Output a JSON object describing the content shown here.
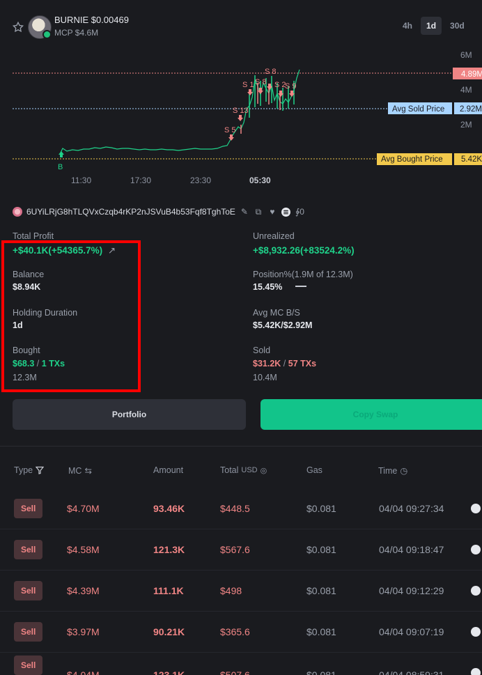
{
  "token": {
    "name_price": "BURNIE $0.00469",
    "mcp": "MCP $4.6M"
  },
  "timeframes": [
    "4h",
    "1d",
    "30d"
  ],
  "chart": {
    "y_ticks": [
      "6M",
      "4M",
      "2M"
    ],
    "x_ticks": [
      "11:30",
      "17:30",
      "23:30",
      "05:30"
    ],
    "current_price_tag": "4.89M",
    "avg_sold_label": "Avg Sold Price",
    "avg_sold_value": "2.92M",
    "avg_bought_label": "Avg Bought Price",
    "avg_bought_value": "5.42K",
    "markers": [
      "S 8",
      "S 1",
      "S 8",
      "S 2",
      "S 9",
      "S 13",
      "S 5",
      "B"
    ],
    "colors": {
      "up": "#1fd28a",
      "down": "#f08585",
      "sold_tag": "#a8d4ff",
      "bought_tag": "#f2c94c"
    }
  },
  "wallet": {
    "address": "6UYiLRjG8hTLQVxCzqb4rKP2nJSVuB4b53Fqf8TghToE",
    "extra": "0"
  },
  "stats": {
    "total_profit_label": "Total Profit",
    "total_profit_value": "+$40.1K(+54365.7%)",
    "unrealized_label": "Unrealized",
    "unrealized_value": "+$8,932.26(+83524.2%)",
    "balance_label": "Balance",
    "balance_value": "$8.94K",
    "position_label": "Position%(1.9M of 12.3M)",
    "position_value": "15.45%",
    "holding_label": "Holding Duration",
    "holding_value": "1d",
    "avg_mc_label": "Avg MC B/S",
    "avg_mc_value": "$5.42K/$2.92M",
    "bought_label": "Bought",
    "bought_amount": "$68.3",
    "bought_sep": "/",
    "bought_txs": "1 TXs",
    "bought_qty": "12.3M",
    "sold_label": "Sold",
    "sold_amount": "$31.2K",
    "sold_sep": "/",
    "sold_txs": "57 TXs",
    "sold_qty": "10.4M"
  },
  "buttons": {
    "portfolio": "Portfolio",
    "copy_swap": "Copy Swap"
  },
  "table": {
    "headers": {
      "type": "Type",
      "mc": "MC",
      "amount": "Amount",
      "total": "Total",
      "usd": "USD",
      "gas": "Gas",
      "time": "Time"
    },
    "rows": [
      {
        "type": "Sell",
        "mc": "$4.70M",
        "amount": "93.46K",
        "total": "$448.5",
        "gas": "$0.081",
        "time": "04/04 09:27:34"
      },
      {
        "type": "Sell",
        "mc": "$4.58M",
        "amount": "121.3K",
        "total": "$567.6",
        "gas": "$0.081",
        "time": "04/04 09:18:47"
      },
      {
        "type": "Sell",
        "mc": "$4.39M",
        "amount": "111.1K",
        "total": "$498",
        "gas": "$0.081",
        "time": "04/04 09:12:29"
      },
      {
        "type": "Sell",
        "mc": "$3.97M",
        "amount": "90.21K",
        "total": "$365.6",
        "gas": "$0.081",
        "time": "04/04 09:07:19"
      },
      {
        "type": "Sell",
        "mc": "$4.04M",
        "amount": "123.1K",
        "total": "$507.6",
        "gas": "$0.081",
        "time": "04/04 08:59:31"
      }
    ]
  }
}
